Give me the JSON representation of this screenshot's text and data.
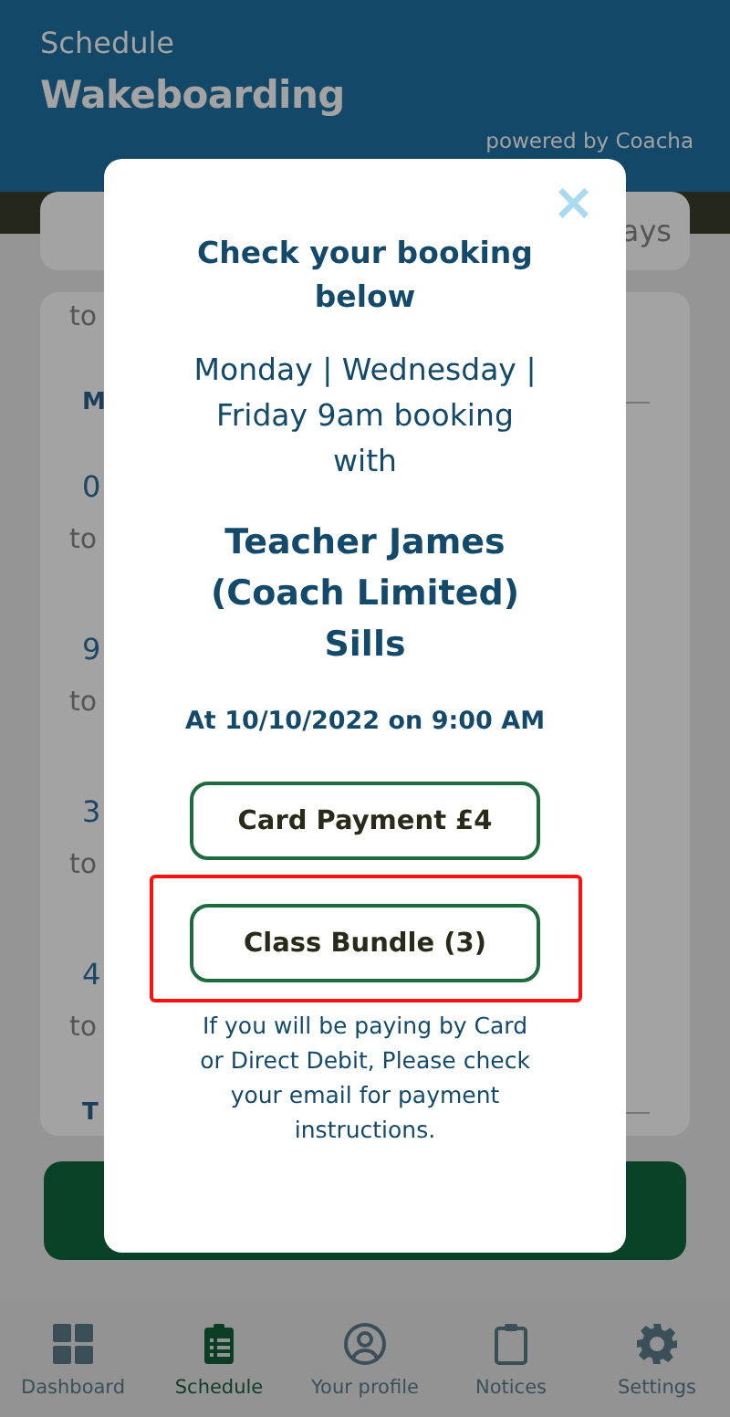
{
  "header": {
    "section": "Schedule",
    "title": "Wakeboarding",
    "powered_by": "powered by Coacha"
  },
  "background": {
    "tab_text": "ays",
    "schedule": [
      {
        "kind": "to",
        "text": "to"
      },
      {
        "kind": "day",
        "text": "M"
      },
      {
        "kind": "time",
        "text": "0"
      },
      {
        "kind": "to",
        "text": "to"
      },
      {
        "kind": "time",
        "text": "9"
      },
      {
        "kind": "to",
        "text": "to"
      },
      {
        "kind": "time",
        "text": "3"
      },
      {
        "kind": "to",
        "text": "to"
      },
      {
        "kind": "time",
        "text": "4"
      },
      {
        "kind": "to",
        "text": "to"
      },
      {
        "kind": "day",
        "text": "T"
      }
    ]
  },
  "modal": {
    "close": "×",
    "title": "Check your booking below",
    "schedule": "Monday | Wednesday | Friday 9am booking with",
    "teacher": "Teacher James (Coach Limited) Sills",
    "date": "At 10/10/2022 on 9:00 AM",
    "buttons": [
      {
        "label": "Card Payment £4",
        "highlighted": false
      },
      {
        "label": "Class Bundle (3)",
        "highlighted": true
      }
    ],
    "note": "If you will be paying by Card or Direct Debit, Please check your email for payment instructions."
  },
  "nav": [
    {
      "label": "Dashboard",
      "selected": false
    },
    {
      "label": "Schedule",
      "selected": true
    },
    {
      "label": "Your profile",
      "selected": false
    },
    {
      "label": "Notices",
      "selected": false
    },
    {
      "label": "Settings",
      "selected": false
    }
  ]
}
